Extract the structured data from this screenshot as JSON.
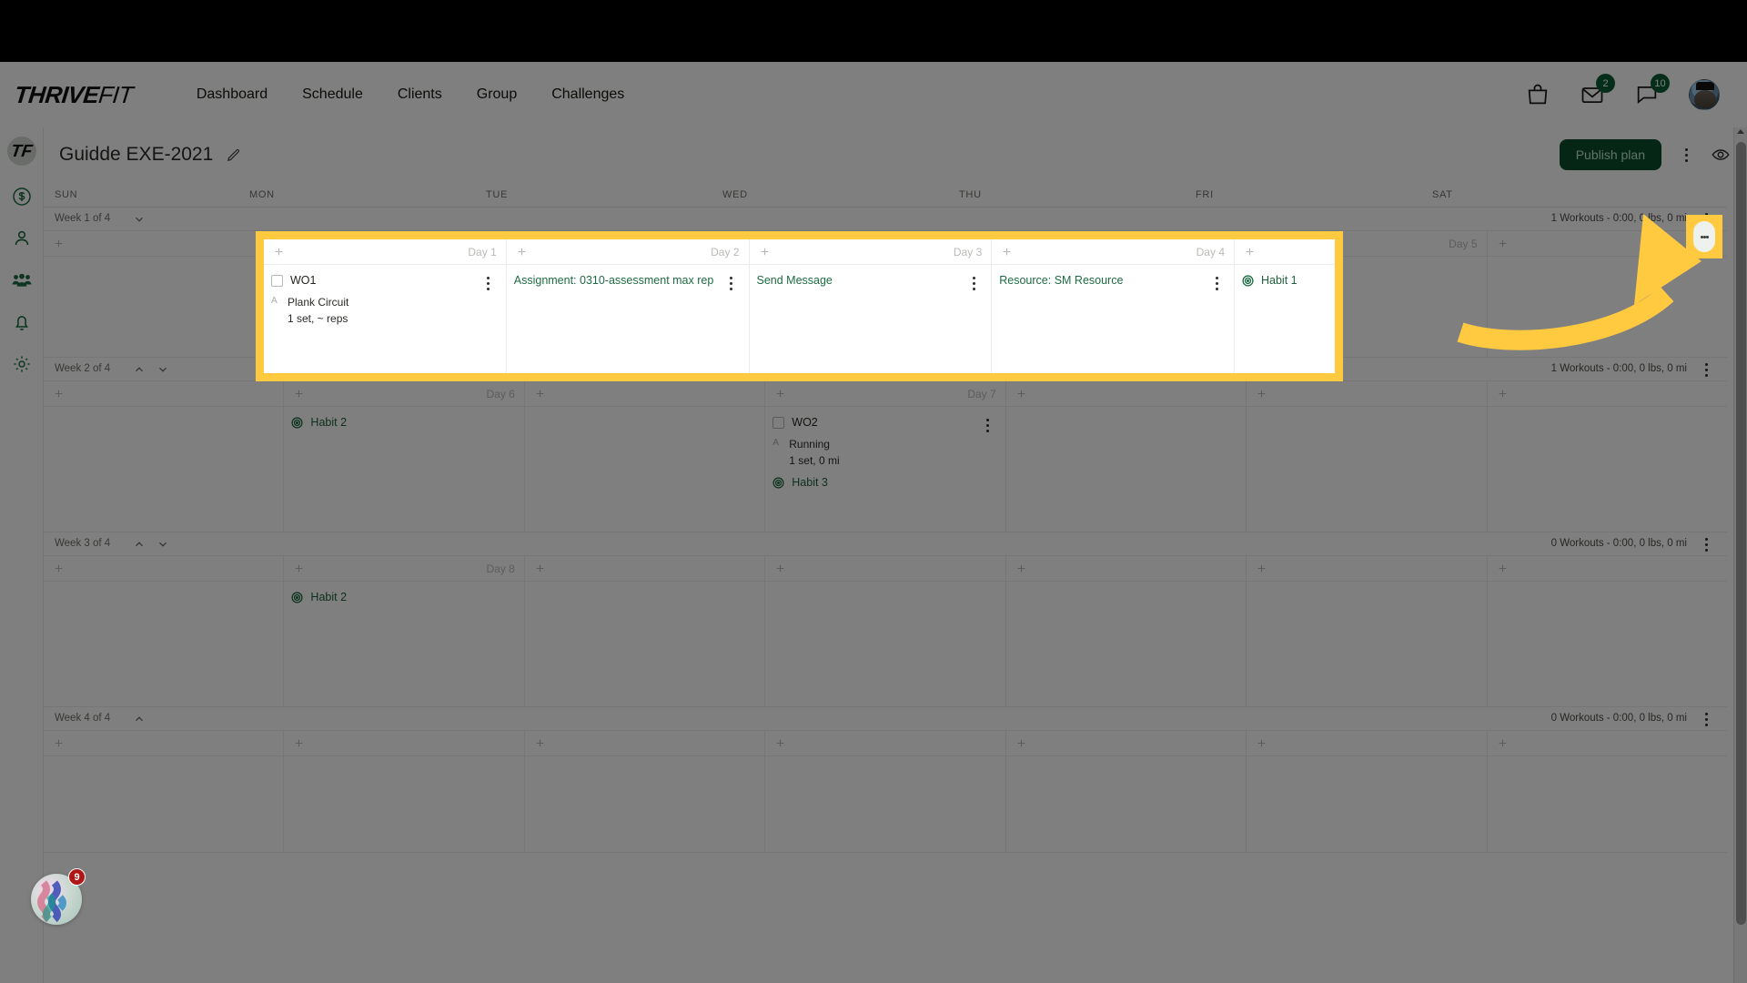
{
  "brand": {
    "logo_primary": "THRIVE",
    "logo_secondary": "FIT",
    "rail_logo": "TF",
    "accent_green": "#0a4d2b",
    "highlight_yellow": "#ffc940"
  },
  "nav": {
    "items": [
      {
        "label": "Dashboard"
      },
      {
        "label": "Schedule"
      },
      {
        "label": "Clients"
      },
      {
        "label": "Group"
      },
      {
        "label": "Challenges"
      }
    ]
  },
  "header_right": {
    "bag_icon": "shopping-bag-icon",
    "mail_icon": "envelope-icon",
    "mail_badge": "2",
    "chat_icon": "chat-bubble-icon",
    "chat_badge": "10",
    "avatar": "user-avatar"
  },
  "rail": {
    "items": [
      {
        "icon": "dollar-circle-icon",
        "name": "billing"
      },
      {
        "icon": "user-icon",
        "name": "clients"
      },
      {
        "icon": "group-icon",
        "name": "groups"
      },
      {
        "icon": "bell-icon",
        "name": "notifications"
      },
      {
        "icon": "gear-icon",
        "name": "settings"
      }
    ]
  },
  "page": {
    "title": "Guidde EXE-2021",
    "edit_icon": "pencil-icon",
    "publish_label": "Publish plan",
    "more_icon": "kebab-menu-icon",
    "preview_icon": "eye-icon"
  },
  "calendar": {
    "day_headers": [
      "SUN",
      "MON",
      "TUE",
      "WED",
      "THU",
      "FRI",
      "SAT"
    ],
    "weeks": [
      {
        "label": "Week 1 of 4",
        "chevrons": [
          "down"
        ],
        "summary": "1 Workouts - 0:00, 0 lbs, 0 mi",
        "days": [
          {
            "day_label": "",
            "items": []
          },
          {
            "day_label": "Day 1",
            "items": [
              {
                "type": "workout",
                "title": "WO1",
                "checkbox": true,
                "kebab": true,
                "exercises": [
                  {
                    "letter": "A",
                    "name": "Plank Circuit",
                    "sets": "1 set, ~ reps"
                  }
                ]
              }
            ]
          },
          {
            "day_label": "Day 2",
            "items": [
              {
                "type": "assignment",
                "title": "Assignment: 0310-assessment max rep",
                "kebab": true
              }
            ]
          },
          {
            "day_label": "Day 3",
            "items": [
              {
                "type": "message",
                "title": "Send Message",
                "kebab": true
              }
            ]
          },
          {
            "day_label": "Day 4",
            "items": [
              {
                "type": "resource",
                "title": "Resource: SM Resource",
                "kebab": true
              }
            ]
          },
          {
            "day_label": "",
            "items": [
              {
                "type": "habit",
                "title": "Habit 1"
              }
            ]
          },
          {
            "day_label": "Day 5",
            "items": []
          }
        ]
      },
      {
        "label": "Week 2 of 4",
        "chevrons": [
          "up",
          "down"
        ],
        "summary": "1 Workouts - 0:00, 0 lbs, 0 mi",
        "days": [
          {
            "day_label": "",
            "items": []
          },
          {
            "day_label": "Day 6",
            "items": [
              {
                "type": "habit",
                "title": "Habit 2"
              }
            ]
          },
          {
            "day_label": "",
            "items": []
          },
          {
            "day_label": "Day 7",
            "items": [
              {
                "type": "workout",
                "title": "WO2",
                "checkbox": true,
                "kebab": true,
                "exercises": [
                  {
                    "letter": "A",
                    "name": "Running",
                    "sets": "1 set, 0 mi"
                  }
                ]
              },
              {
                "type": "habit",
                "title": "Habit 3"
              }
            ]
          },
          {
            "day_label": "",
            "items": []
          },
          {
            "day_label": "",
            "items": []
          },
          {
            "day_label": "",
            "items": []
          }
        ]
      },
      {
        "label": "Week 3 of 4",
        "chevrons": [
          "up",
          "down"
        ],
        "summary": "0 Workouts - 0:00, 0 lbs, 0 mi",
        "days": [
          {
            "day_label": "",
            "items": []
          },
          {
            "day_label": "Day 8",
            "items": [
              {
                "type": "habit",
                "title": "Habit 2"
              }
            ]
          },
          {
            "day_label": "",
            "items": []
          },
          {
            "day_label": "",
            "items": []
          },
          {
            "day_label": "",
            "items": []
          },
          {
            "day_label": "",
            "items": []
          },
          {
            "day_label": "",
            "items": []
          }
        ]
      },
      {
        "label": "Week 4 of 4",
        "chevrons": [
          "up"
        ],
        "summary": "0 Workouts - 0:00, 0 lbs, 0 mi",
        "days": [
          {
            "day_label": "",
            "items": []
          },
          {
            "day_label": "",
            "items": []
          },
          {
            "day_label": "",
            "items": []
          },
          {
            "day_label": "",
            "items": []
          },
          {
            "day_label": "",
            "items": []
          },
          {
            "day_label": "",
            "items": []
          },
          {
            "day_label": "",
            "items": []
          }
        ]
      }
    ]
  },
  "highlight": {
    "card_box": "week-1-day-cards",
    "kebab_box": "week-1-options-kebab",
    "arrow": "pointer-arrow"
  },
  "fab": {
    "icon": "waves-widget-icon",
    "badge": "9"
  }
}
